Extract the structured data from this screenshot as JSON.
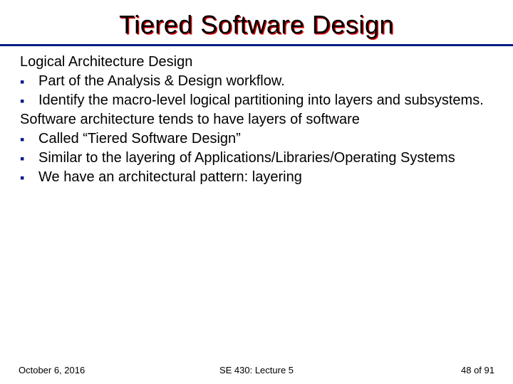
{
  "title": "Tiered Software Design",
  "sections": [
    {
      "label": "Logical Architecture Design",
      "bullets": [
        "Part of the Analysis & Design workflow.",
        "Identify the macro-level logical partitioning into layers and subsystems."
      ]
    },
    {
      "label": "Software architecture tends to have layers of software",
      "bullets": [
        "Called “Tiered Software Design”",
        "Similar to the layering of Applications/Libraries/Operating Systems",
        "We have an architectural pattern: layering"
      ]
    }
  ],
  "footer": {
    "date": "October 6, 2016",
    "course": "SE 430: Lecture 5",
    "page": "48 of 91"
  }
}
